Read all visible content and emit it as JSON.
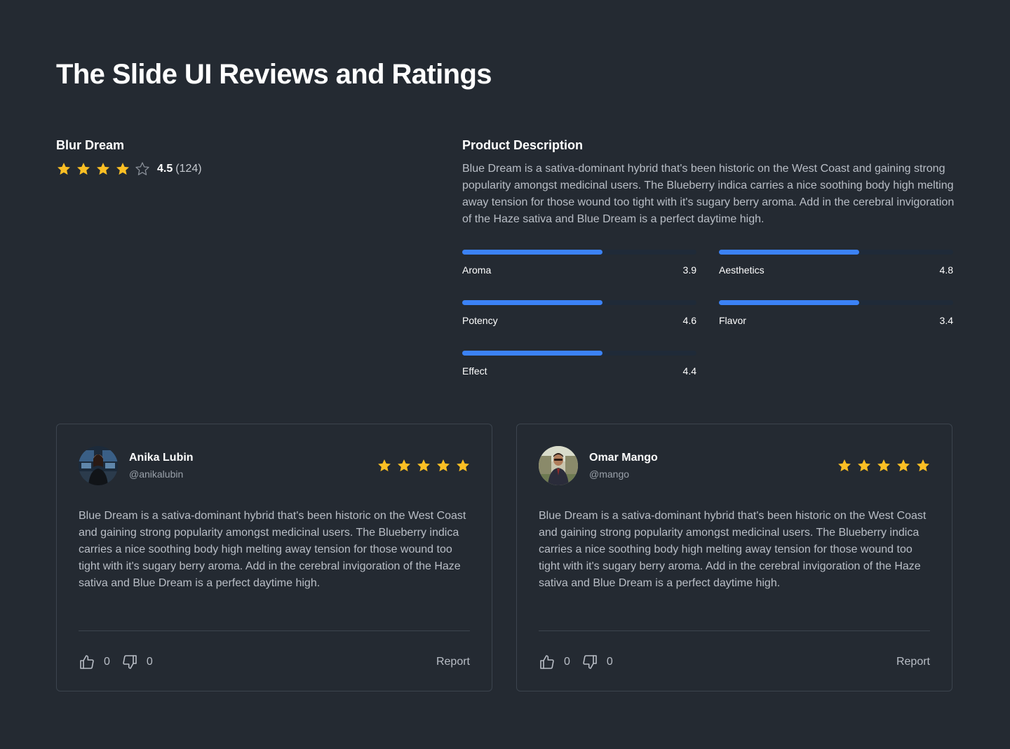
{
  "page": {
    "title": "The Slide UI Reviews and Ratings"
  },
  "product": {
    "name": "Blur Dream",
    "rating": "4.5",
    "rating_count": "(124)",
    "stars_filled": 4,
    "stars_total": 5
  },
  "description": {
    "heading": "Product Description",
    "text": "Blue Dream is a sativa-dominant hybrid that's been historic on the West Coast and gaining strong popularity amongst medicinal users. The Blueberry indica carries a nice soothing body high melting away tension for those wound too tight with it's sugary berry aroma. Add in the cerebral invigoration of the Haze sativa and Blue Dream is a perfect daytime high."
  },
  "attributes": [
    {
      "label": "Aroma",
      "value": "3.9",
      "fill": 0.6
    },
    {
      "label": "Aesthetics",
      "value": "4.8",
      "fill": 0.6
    },
    {
      "label": "Potency",
      "value": "4.6",
      "fill": 0.6
    },
    {
      "label": "Flavor",
      "value": "3.4",
      "fill": 0.6
    },
    {
      "label": "Effect",
      "value": "4.4",
      "fill": 0.6
    }
  ],
  "reviews": [
    {
      "name": "Anika Lubin",
      "handle": "@anikalubin",
      "stars": 5,
      "text": "Blue Dream is a sativa-dominant hybrid that's been historic on the West Coast and gaining strong popularity amongst medicinal users. The Blueberry indica carries a nice soothing body high melting away tension for those wound too tight with it's sugary berry aroma. Add in the cerebral invigoration of the Haze sativa and Blue Dream is a perfect daytime high.",
      "likes": "0",
      "dislikes": "0",
      "report_label": "Report"
    },
    {
      "name": "Omar Mango",
      "handle": "@mango",
      "stars": 5,
      "text": "Blue Dream is a sativa-dominant hybrid that's been historic on the West Coast and gaining strong popularity amongst medicinal users. The Blueberry indica carries a nice soothing body high melting away tension for those wound too tight with it's sugary berry aroma. Add in the cerebral invigoration of the Haze sativa and Blue Dream is a perfect daytime high.",
      "likes": "0",
      "dislikes": "0",
      "report_label": "Report"
    }
  ],
  "icons": {
    "star_filled": "star-icon",
    "star_empty": "star-outline-icon",
    "thumbs_up": "thumbs-up-icon",
    "thumbs_down": "thumbs-down-icon"
  },
  "colors": {
    "background": "#242a32",
    "star": "#fbbf24",
    "bar_fill": "#3b82f6",
    "bar_track": "#1f2a38",
    "card_border": "#3c444e"
  }
}
